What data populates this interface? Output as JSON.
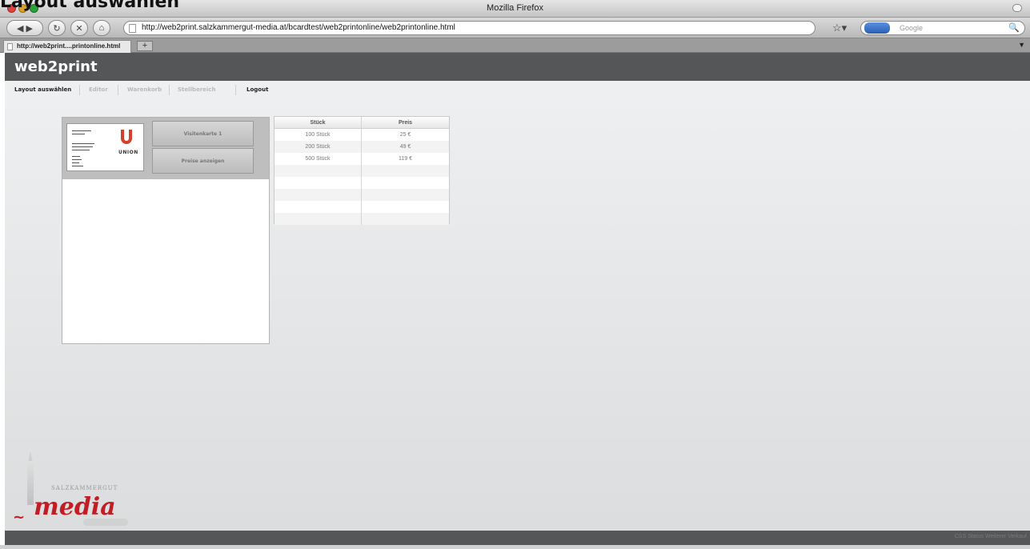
{
  "overlay_heading": "Layout auswählen",
  "window": {
    "title": "Mozilla Firefox"
  },
  "toolbar": {
    "url": "http://web2print.salzkammergut-media.at/bcardtest/web2printonline/web2printonline.html",
    "search_placeholder": "Google",
    "back_icon": "◀",
    "forward_icon": "▶",
    "reload_icon": "↻",
    "stop_icon": "✕",
    "home_icon": "⌂",
    "star_icon": "☆▾",
    "search_icon": "🔍"
  },
  "tab": {
    "label": "http://web2print....printonline.html",
    "new_tab_label": "+"
  },
  "app": {
    "title": "web2print",
    "menu": [
      {
        "label": "Layout auswählen",
        "active": true
      },
      {
        "label": "Editor",
        "active": false
      },
      {
        "label": "Warenkorb",
        "active": false
      },
      {
        "label": "Stellbereich",
        "active": false
      },
      {
        "label": "Logout",
        "active": true
      }
    ],
    "layout": {
      "card_brand": "UNION",
      "button_card": "Visitenkarte 1",
      "button_prices": "Preise anzeigen"
    },
    "price_table": {
      "headers": [
        "Stück",
        "Preis"
      ],
      "rows": [
        [
          "100 Stück",
          "25 €"
        ],
        [
          "200 Stück",
          "49 €"
        ],
        [
          "500 Stück",
          "119 €"
        ]
      ]
    },
    "logo": {
      "small": "SALZKAMMERGUT",
      "main": "media"
    },
    "footer": {
      "links": "CSS Status   Weiterer Verkauf"
    }
  },
  "colors": {
    "header": "#555658",
    "brand_red": "#c21d24",
    "union_orange": "#d3402b"
  }
}
